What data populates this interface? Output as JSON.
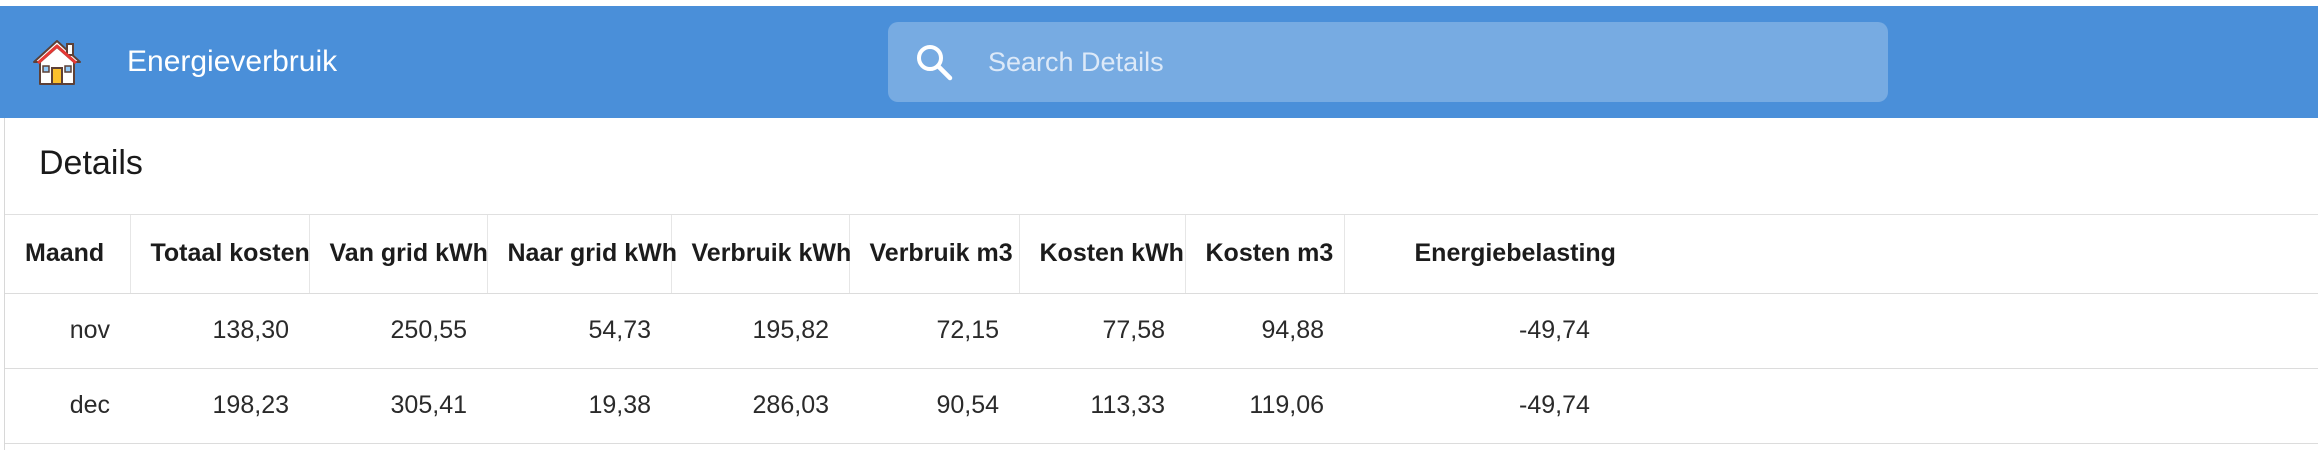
{
  "app": {
    "title": "Energieverbruik",
    "icon": "house-icon",
    "colors": {
      "header": "#4a8fd9",
      "house_roof": "#e53935",
      "house_door": "#fbc02d"
    }
  },
  "search": {
    "placeholder": "Search Details",
    "value": "",
    "icon": "search-icon"
  },
  "panel": {
    "title": "Details"
  },
  "table": {
    "columns": [
      "Maand",
      "Totaal kosten",
      "Van grid kWh",
      "Naar grid kWh",
      "Verbruik kWh",
      "Verbruik m3",
      "Kosten kWh",
      "Kosten m3",
      "Energiebelasting"
    ],
    "rows": [
      [
        "nov",
        "138,30",
        "250,55",
        "54,73",
        "195,82",
        "72,15",
        "77,58",
        "94,88",
        "-49,74"
      ],
      [
        "dec",
        "198,23",
        "305,41",
        "19,38",
        "286,03",
        "90,54",
        "113,33",
        "119,06",
        "-49,74"
      ]
    ]
  }
}
